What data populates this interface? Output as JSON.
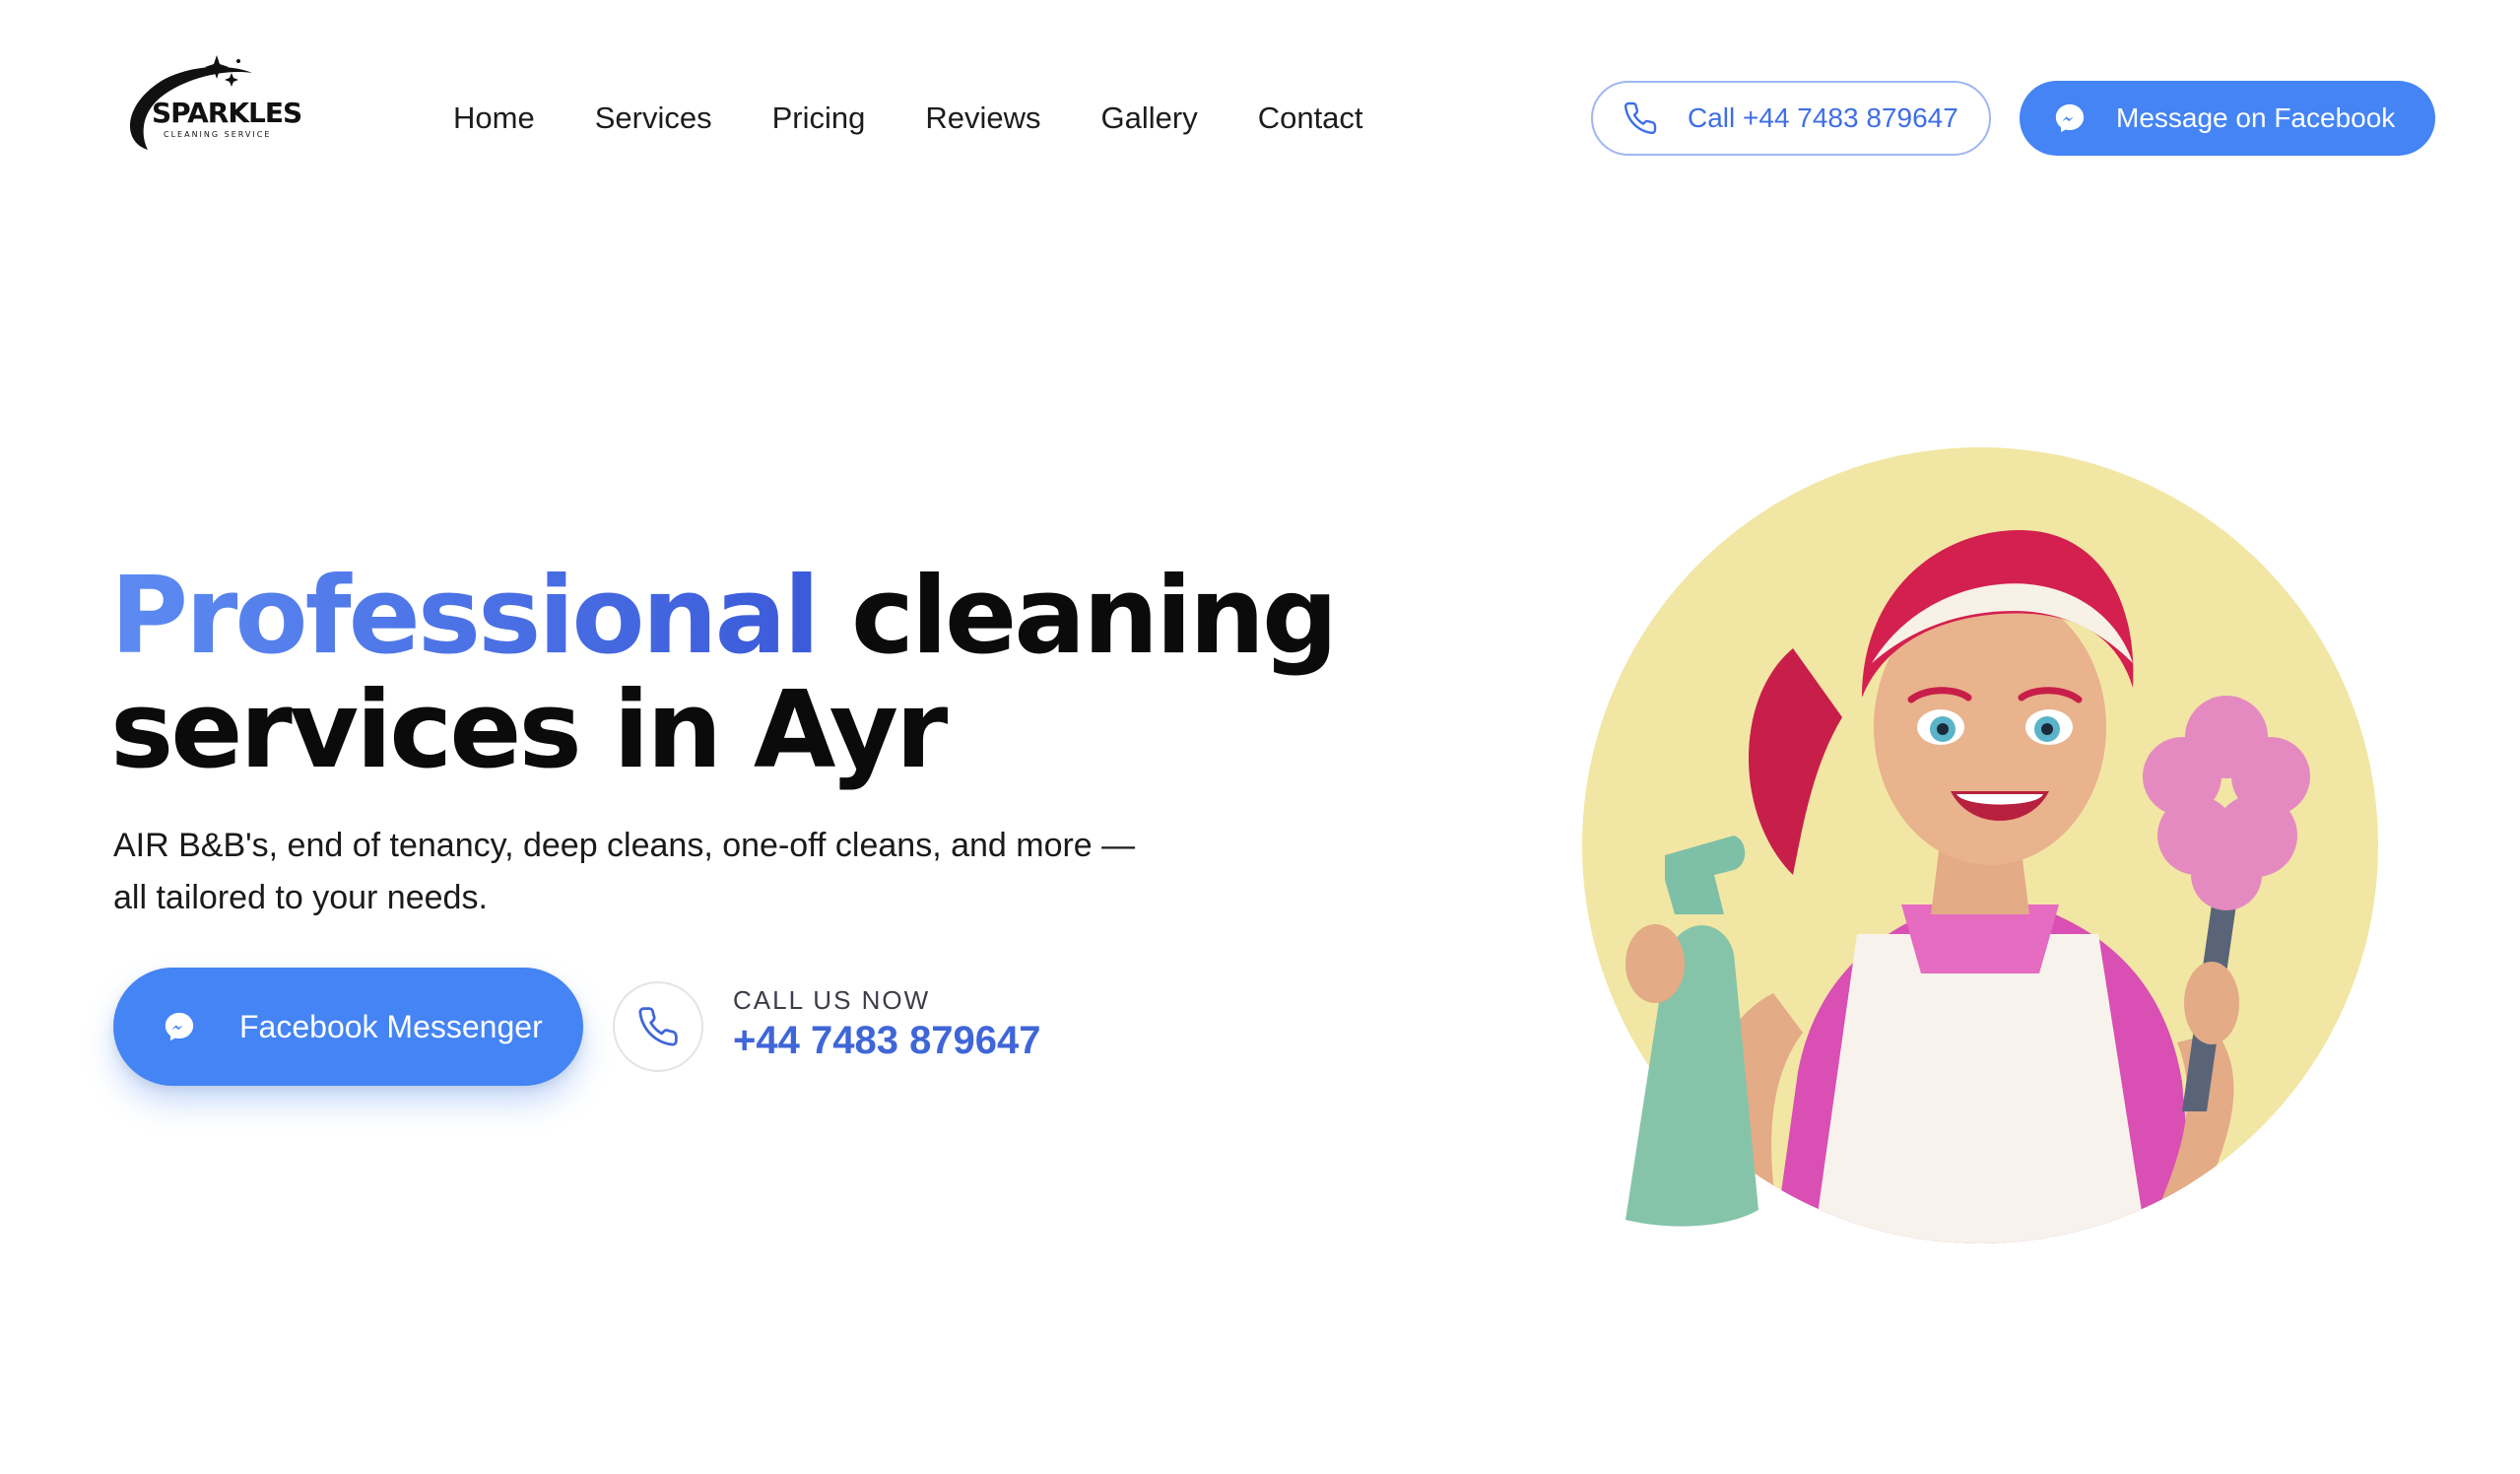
{
  "logo": {
    "title": "SPARKLES",
    "subtitle": "CLEANING SERVICE"
  },
  "nav": {
    "items": [
      {
        "label": "Home"
      },
      {
        "label": "Services"
      },
      {
        "label": "Pricing"
      },
      {
        "label": "Reviews"
      },
      {
        "label": "Gallery"
      },
      {
        "label": "Contact"
      }
    ]
  },
  "header": {
    "call_label": "Call +44 7483 879647",
    "facebook_label": "Message on Facebook"
  },
  "hero": {
    "title_accent": "Professional",
    "title_rest_line1": " cleaning",
    "title_line2": "services in Ayr",
    "description": "AIR B&B's, end of tenancy, deep cleans, one-off cleans, and more — all tailored to your needs.",
    "messenger_button": "Facebook Messenger",
    "call_caption": "CALL US NOW",
    "call_number": "+44 7483 879647"
  },
  "icons": {
    "phone": "phone-icon",
    "messenger": "messenger-icon",
    "sparkle": "sparkle-icon"
  },
  "colors": {
    "primary": "#4484f4",
    "accent_text": "#3f66d8",
    "call_border": "#9fb6f4",
    "illustration_bg": "#f3e7a6"
  }
}
